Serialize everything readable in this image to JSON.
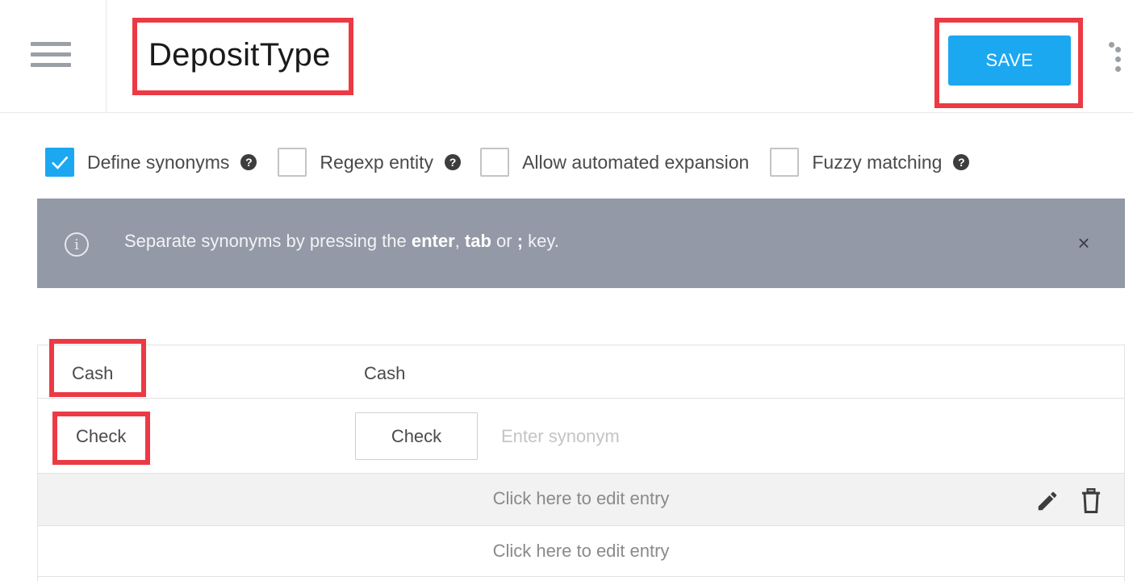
{
  "header": {
    "title": "DepositType",
    "save_label": "SAVE"
  },
  "options": [
    {
      "label": "Define synonyms",
      "checked": true,
      "help": true
    },
    {
      "label": "Regexp entity",
      "checked": false,
      "help": true
    },
    {
      "label": "Allow automated expansion",
      "checked": false,
      "help": false
    },
    {
      "label": "Fuzzy matching",
      "checked": false,
      "help": true
    }
  ],
  "banner": {
    "text_before": "Separate synonyms by pressing the ",
    "key1": "enter",
    "sep1": ", ",
    "key2": "tab",
    "sep2": " or ",
    "key3": ";",
    "text_after": " key.",
    "close": "×",
    "info": "i"
  },
  "entries": {
    "row1": {
      "value": "Cash",
      "synonym": "Cash"
    },
    "row2": {
      "value": "Check",
      "synonym_chip": "Check",
      "placeholder": "Enter synonym"
    },
    "row3": {
      "edit_text": "Click here to edit entry"
    },
    "row4": {
      "edit_text": "Click here to edit entry"
    }
  },
  "icons": {
    "menu": "hamburger-icon",
    "more": "more-vertical-icon",
    "help": "question-circle-icon",
    "info": "info-circle-icon",
    "close": "close-icon",
    "edit": "pencil-icon",
    "delete": "trash-icon",
    "check": "checkmark-icon"
  },
  "colors": {
    "accent": "#1ba8f0",
    "highlight": "#ec3a45",
    "banner": "#9399a6"
  }
}
